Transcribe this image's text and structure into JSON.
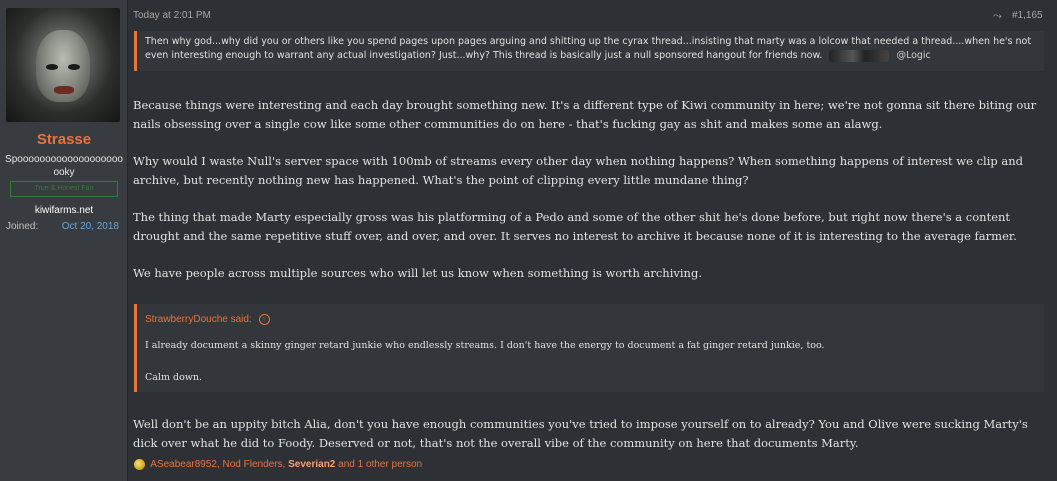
{
  "user": {
    "name": "Strasse",
    "title": "Spoooooooooooooooooooooky",
    "banner": "True & Honest Fan",
    "site": "kiwifarms.net",
    "joined_label": "Joined:",
    "joined_value": "Oct 20, 2018"
  },
  "meta": {
    "time": "Today at 2:01 PM",
    "post_number": "#1,165"
  },
  "quote_top": {
    "text": "Then why god...why did you or others like you spend pages upon pages arguing and shitting up the cyrax thread...insisting that marty was a lolcow that needed a thread....when he's not even interesting enough to warrant any actual investigation? Just...why? This thread is basically just a null sponsored hangout for friends now.",
    "mention": "@Logic"
  },
  "body": {
    "p1": "Because things were interesting and each day brought something new. It's a different type of Kiwi community in here; we're not gonna sit there biting our nails obsessing over a single cow like some other communities do on here - that's fucking gay as shit and makes some an alawg.",
    "p2": "Why would I waste Null's server space with 100mb of streams every other day when nothing happens? When something happens of interest we clip and archive, but recently nothing new has happened. What's the point of clipping every little mundane thing?",
    "p3": "The thing that made Marty especially gross was his platforming of a Pedo and some of the other shit he's done before, but right now there's a content drought and the same repetitive stuff over, and over, and over. It serves no interest to archive it because none of it is interesting to the average farmer.",
    "p4": "We have people across multiple sources who will let us know when something is worth archiving.",
    "p5": "Well don't be an uppity bitch Alia, don't you have enough communities you've tried to impose yourself on to already? You and Olive were sucking Marty's dick over what he did to Foody. Deserved or not, that's not the overall vibe of the community on here that documents Marty."
  },
  "quote_box": {
    "author": "StrawberryDouche said:",
    "line1": "I already document a skinny ginger retard junkie who endlessly streams. I don't have the energy to document a fat ginger retard junkie, too.",
    "line2": "Calm down."
  },
  "reactions": {
    "users": "ASeabear8952, Nod Flenders, ",
    "bold_user": "Severian2",
    "rest": " and 1 other person"
  }
}
